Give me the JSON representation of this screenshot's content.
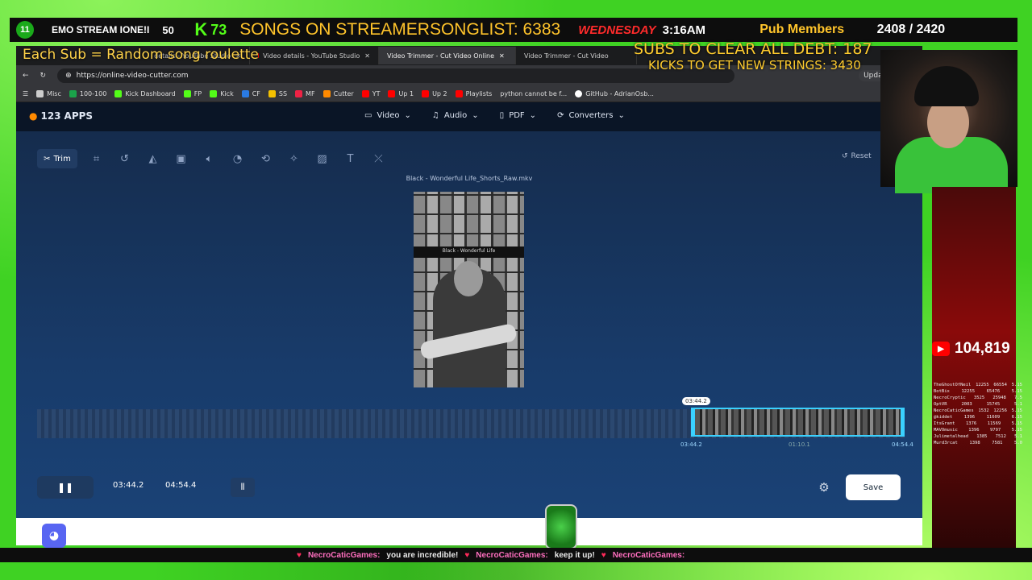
{
  "stream": {
    "topbar": {
      "badge": "11",
      "title": "EMO STREAM IONE!I",
      "count1": "50",
      "kick_count": "73",
      "songs": "SONGS ON STREAMERSONGLIST: 6383",
      "day": "WEDNESDAY",
      "time": "3:16AM",
      "pub_label": "Pub Members",
      "pub_count": "2408 / 2420"
    },
    "overlay_left": "Each Sub = Random song roulette",
    "overlay_subs": "SUBS TO CLEAR ALL DEBT: 187",
    "overlay_kicks": "KICKS TO GET NEW STRINGS: 3430",
    "yt_subscribers": "104,819",
    "leaderboard": [
      {
        "name": "TheGhostOfNeil",
        "a": "12255",
        "b": "66554",
        "c": "5.15"
      },
      {
        "name": "BotBix",
        "a": "12255",
        "b": "65476",
        "c": "5.15"
      },
      {
        "name": "NecroCryptic",
        "a": "3525",
        "b": "25948",
        "c": "7.5"
      },
      {
        "name": "OptVR",
        "a": "2003",
        "b": "15745",
        "c": "5.1"
      },
      {
        "name": "NecroCaticGames",
        "a": "1532",
        "b": "12256",
        "c": "5.15"
      },
      {
        "name": "@kiddet",
        "a": "1396",
        "b": "11609",
        "c": "6.15"
      },
      {
        "name": "ItsGrant",
        "a": "1376",
        "b": "11569",
        "c": "5.15"
      },
      {
        "name": "MAVOmusic",
        "a": "1396",
        "b": "9797",
        "c": "5.15"
      },
      {
        "name": "Julimetalhead",
        "a": "1385",
        "b": "7512",
        "c": "5.1"
      },
      {
        "name": "Murd3rcat",
        "a": "1398",
        "b": "7581",
        "c": "5.0"
      }
    ],
    "ticker": [
      {
        "name": "NecroCaticGames:",
        "msg": "you are incredible!"
      },
      {
        "name": "NecroCaticGames:",
        "msg": "keep it up!"
      },
      {
        "name": "NecroCaticGames:",
        "msg": ""
      }
    ]
  },
  "browser": {
    "tabs": [
      {
        "title": "details - YouTube Studio",
        "active": false
      },
      {
        "title": "Video details - YouTube Studio",
        "active": false
      },
      {
        "title": "Video Trimmer - Cut Video Online",
        "active": true
      },
      {
        "title": "Video Trimmer - Cut Video",
        "active": false
      }
    ],
    "url": "https://online-video-cutter.com",
    "update_label": "Update",
    "bookmarks": [
      "Misc",
      "100-100",
      "Kick Dashboard",
      "FP",
      "Kick",
      "CF",
      "SS",
      "MF",
      "Cutter",
      "YT",
      "Up 1",
      "Up 2",
      "Playlists",
      "python cannot be f...",
      "GitHub - AdrianOsb..."
    ]
  },
  "app": {
    "logo_prefix": "123",
    "logo_suffix": "APPS",
    "nav": [
      "Video",
      "Audio",
      "PDF",
      "Converters"
    ],
    "tools": {
      "trim_label": "Trim"
    },
    "reset_label": "Reset",
    "file_name": "Black - Wonderful Life_Shorts_Raw.mkv",
    "preview_caption": "Black - Wonderful Life",
    "timeline": {
      "marker": "03:44.2",
      "start_label": "03:44.2",
      "mid_label": "01:10.1",
      "end_label": "04:54.4",
      "selection_start_fraction": 0.754,
      "selection_end_fraction": 1.0
    },
    "controls": {
      "start_time": "03:44.2",
      "end_time": "04:54.4",
      "save_label": "Save"
    }
  }
}
